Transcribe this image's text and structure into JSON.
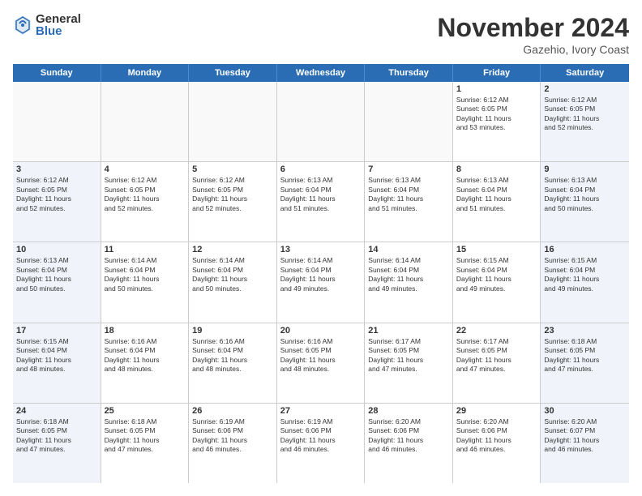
{
  "logo": {
    "general": "General",
    "blue": "Blue"
  },
  "header": {
    "month": "November 2024",
    "location": "Gazehio, Ivory Coast"
  },
  "weekdays": [
    "Sunday",
    "Monday",
    "Tuesday",
    "Wednesday",
    "Thursday",
    "Friday",
    "Saturday"
  ],
  "rows": [
    [
      {
        "day": "",
        "text": ""
      },
      {
        "day": "",
        "text": ""
      },
      {
        "day": "",
        "text": ""
      },
      {
        "day": "",
        "text": ""
      },
      {
        "day": "",
        "text": ""
      },
      {
        "day": "1",
        "text": "Sunrise: 6:12 AM\nSunset: 6:05 PM\nDaylight: 11 hours\nand 53 minutes."
      },
      {
        "day": "2",
        "text": "Sunrise: 6:12 AM\nSunset: 6:05 PM\nDaylight: 11 hours\nand 52 minutes."
      }
    ],
    [
      {
        "day": "3",
        "text": "Sunrise: 6:12 AM\nSunset: 6:05 PM\nDaylight: 11 hours\nand 52 minutes."
      },
      {
        "day": "4",
        "text": "Sunrise: 6:12 AM\nSunset: 6:05 PM\nDaylight: 11 hours\nand 52 minutes."
      },
      {
        "day": "5",
        "text": "Sunrise: 6:12 AM\nSunset: 6:05 PM\nDaylight: 11 hours\nand 52 minutes."
      },
      {
        "day": "6",
        "text": "Sunrise: 6:13 AM\nSunset: 6:04 PM\nDaylight: 11 hours\nand 51 minutes."
      },
      {
        "day": "7",
        "text": "Sunrise: 6:13 AM\nSunset: 6:04 PM\nDaylight: 11 hours\nand 51 minutes."
      },
      {
        "day": "8",
        "text": "Sunrise: 6:13 AM\nSunset: 6:04 PM\nDaylight: 11 hours\nand 51 minutes."
      },
      {
        "day": "9",
        "text": "Sunrise: 6:13 AM\nSunset: 6:04 PM\nDaylight: 11 hours\nand 50 minutes."
      }
    ],
    [
      {
        "day": "10",
        "text": "Sunrise: 6:13 AM\nSunset: 6:04 PM\nDaylight: 11 hours\nand 50 minutes."
      },
      {
        "day": "11",
        "text": "Sunrise: 6:14 AM\nSunset: 6:04 PM\nDaylight: 11 hours\nand 50 minutes."
      },
      {
        "day": "12",
        "text": "Sunrise: 6:14 AM\nSunset: 6:04 PM\nDaylight: 11 hours\nand 50 minutes."
      },
      {
        "day": "13",
        "text": "Sunrise: 6:14 AM\nSunset: 6:04 PM\nDaylight: 11 hours\nand 49 minutes."
      },
      {
        "day": "14",
        "text": "Sunrise: 6:14 AM\nSunset: 6:04 PM\nDaylight: 11 hours\nand 49 minutes."
      },
      {
        "day": "15",
        "text": "Sunrise: 6:15 AM\nSunset: 6:04 PM\nDaylight: 11 hours\nand 49 minutes."
      },
      {
        "day": "16",
        "text": "Sunrise: 6:15 AM\nSunset: 6:04 PM\nDaylight: 11 hours\nand 49 minutes."
      }
    ],
    [
      {
        "day": "17",
        "text": "Sunrise: 6:15 AM\nSunset: 6:04 PM\nDaylight: 11 hours\nand 48 minutes."
      },
      {
        "day": "18",
        "text": "Sunrise: 6:16 AM\nSunset: 6:04 PM\nDaylight: 11 hours\nand 48 minutes."
      },
      {
        "day": "19",
        "text": "Sunrise: 6:16 AM\nSunset: 6:04 PM\nDaylight: 11 hours\nand 48 minutes."
      },
      {
        "day": "20",
        "text": "Sunrise: 6:16 AM\nSunset: 6:05 PM\nDaylight: 11 hours\nand 48 minutes."
      },
      {
        "day": "21",
        "text": "Sunrise: 6:17 AM\nSunset: 6:05 PM\nDaylight: 11 hours\nand 47 minutes."
      },
      {
        "day": "22",
        "text": "Sunrise: 6:17 AM\nSunset: 6:05 PM\nDaylight: 11 hours\nand 47 minutes."
      },
      {
        "day": "23",
        "text": "Sunrise: 6:18 AM\nSunset: 6:05 PM\nDaylight: 11 hours\nand 47 minutes."
      }
    ],
    [
      {
        "day": "24",
        "text": "Sunrise: 6:18 AM\nSunset: 6:05 PM\nDaylight: 11 hours\nand 47 minutes."
      },
      {
        "day": "25",
        "text": "Sunrise: 6:18 AM\nSunset: 6:05 PM\nDaylight: 11 hours\nand 47 minutes."
      },
      {
        "day": "26",
        "text": "Sunrise: 6:19 AM\nSunset: 6:06 PM\nDaylight: 11 hours\nand 46 minutes."
      },
      {
        "day": "27",
        "text": "Sunrise: 6:19 AM\nSunset: 6:06 PM\nDaylight: 11 hours\nand 46 minutes."
      },
      {
        "day": "28",
        "text": "Sunrise: 6:20 AM\nSunset: 6:06 PM\nDaylight: 11 hours\nand 46 minutes."
      },
      {
        "day": "29",
        "text": "Sunrise: 6:20 AM\nSunset: 6:06 PM\nDaylight: 11 hours\nand 46 minutes."
      },
      {
        "day": "30",
        "text": "Sunrise: 6:20 AM\nSunset: 6:07 PM\nDaylight: 11 hours\nand 46 minutes."
      }
    ]
  ]
}
